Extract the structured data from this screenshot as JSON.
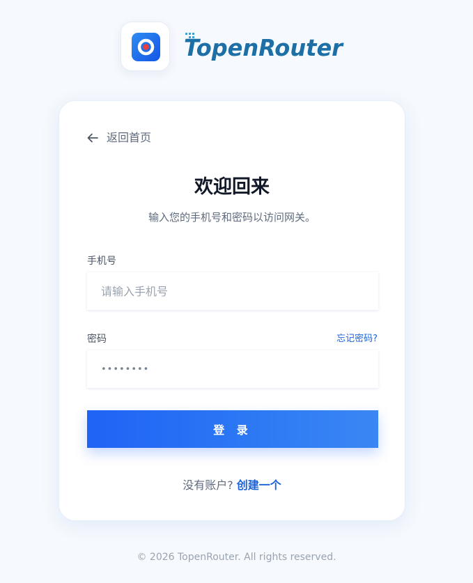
{
  "brand": {
    "logo_text": "TopenRouter",
    "logo_colors": {
      "primary": "#1d6fa5",
      "accent": "#e34b4b",
      "dots": "#38a3d8"
    },
    "app_icon": "ring-logo-icon"
  },
  "card": {
    "back_label": "返回首页",
    "back_icon": "arrow-left-icon",
    "title": "欢迎回来",
    "subtitle": "输入您的手机号和密码以访问网关。",
    "phone": {
      "label": "手机号",
      "placeholder": "请输入手机号",
      "value": ""
    },
    "password": {
      "label": "密码",
      "value": "••••••••",
      "forgot_label": "忘记密码?"
    },
    "login_label": "登 录",
    "signup": {
      "prompt": "没有账户?",
      "link_label": "创建一个"
    }
  },
  "footer": {
    "copyright": "© 2026 TopenRouter. All rights reserved."
  },
  "colors": {
    "accent": "#1f63f5",
    "link": "#1d63d8",
    "background": "#f6f9fd",
    "title": "#111827"
  }
}
